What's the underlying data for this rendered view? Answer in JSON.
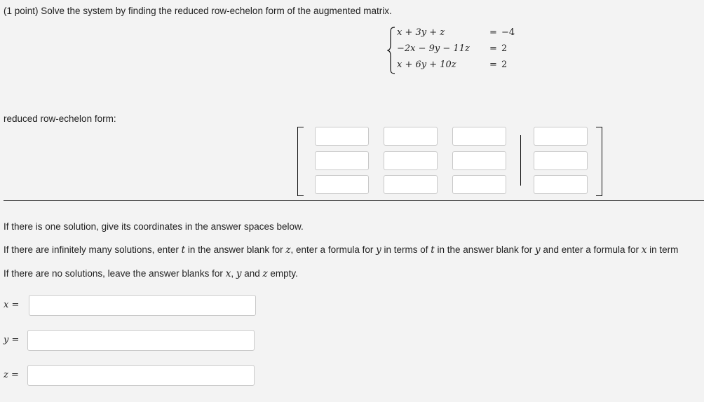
{
  "problem": {
    "prompt": "(1 point) Solve the system by finding the reduced row-echelon form of the augmented matrix."
  },
  "system": {
    "equations": [
      {
        "lhs": "x + 3y + z",
        "rel": "=",
        "rhs": "−4"
      },
      {
        "lhs": "−2x − 9y − 11z",
        "rel": "=",
        "rhs": "2"
      },
      {
        "lhs": "x + 6y + 10z",
        "rel": "=",
        "rhs": "2"
      }
    ]
  },
  "rref": {
    "label": "reduced row-echelon form:",
    "cells": [
      [
        "",
        "",
        "",
        ""
      ],
      [
        "",
        "",
        "",
        ""
      ],
      [
        "",
        "",
        "",
        ""
      ]
    ]
  },
  "instructions": {
    "one_solution": "If there is one solution, give its coordinates in the answer spaces below.",
    "infinite": {
      "p1": "If there are infinitely many solutions, enter ",
      "t1": "t",
      "p2": " in the answer blank for ",
      "z1": "z",
      "p3": ", enter a formula for ",
      "y1": "y",
      "p4": " in terms of ",
      "t2": "t",
      "p5": " in the answer blank for ",
      "y2": "y",
      "p6": " and enter a formula for ",
      "x1": "x",
      "p7": " in term"
    },
    "none": {
      "p1": "If there are no solutions, leave the answer blanks for ",
      "x": "x",
      "p2": ", ",
      "y": "y",
      "p3": " and ",
      "z": "z",
      "p4": " empty."
    }
  },
  "answers": {
    "x": {
      "var": "x",
      "rel": " =",
      "value": ""
    },
    "y": {
      "var": "y",
      "rel": " =",
      "value": ""
    },
    "z": {
      "var": "z",
      "rel": " =",
      "value": ""
    }
  }
}
